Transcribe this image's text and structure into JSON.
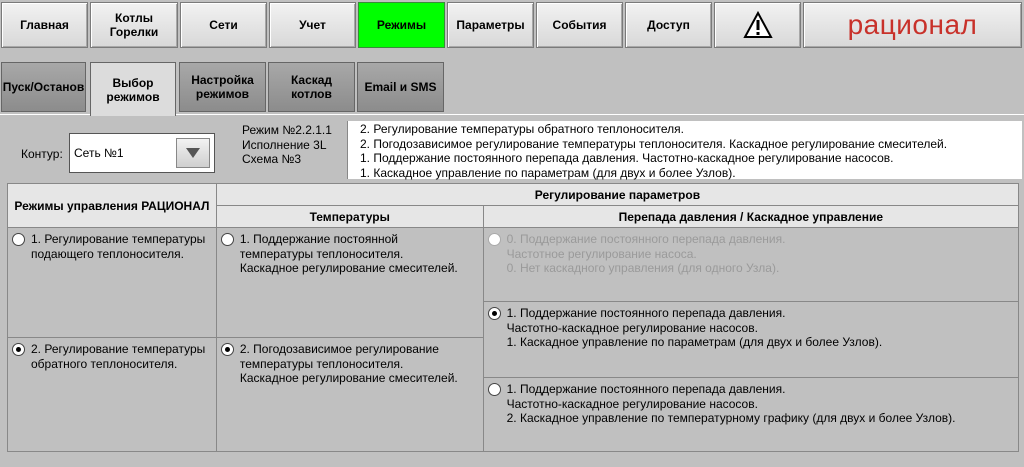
{
  "nav": {
    "items": [
      {
        "label": "Главная"
      },
      {
        "label": "Котлы\nГорелки"
      },
      {
        "label": "Сети"
      },
      {
        "label": "Учет"
      },
      {
        "label": "Режимы"
      },
      {
        "label": "Параметры"
      },
      {
        "label": "События"
      },
      {
        "label": "Доступ"
      }
    ],
    "brand": "рационал",
    "active_color": "#00ff00"
  },
  "tabs": [
    {
      "label": "Пуск/Останов"
    },
    {
      "label": "Выбор\nрежимов"
    },
    {
      "label": "Настройка\nрежимов"
    },
    {
      "label": "Каскад\nкотлов"
    },
    {
      "label": "Email и SMS"
    }
  ],
  "contour": {
    "label": "Контур:",
    "value": "Сеть №1"
  },
  "mode_info": {
    "line1": "Режим №2.2.1.1",
    "line2": "Исполнение 3L",
    "line3": "Схема №3"
  },
  "mode_desc": [
    "2. Регулирование температуры обратного теплоносителя.",
    "2. Погодозависимое регулирование температуры теплоносителя. Каскадное регулирование смесителей.",
    "1. Поддержание постоянного перепада давления. Частотно-каскадное регулирование насосов.",
    "1. Каскадное управление по параметрам (для двух и более Узлов)."
  ],
  "grid": {
    "col1_header": "Режимы управления РАЦИОНАЛ",
    "params_header": "Регулирование параметров",
    "temp_header": "Температуры",
    "pressure_header": "Перепада давления / Каскадное управление",
    "rational_modes": [
      {
        "text": "1. Регулирование температуры\nподающего теплоносителя.",
        "selected": false
      },
      {
        "text": "2. Регулирование температуры\nобратного теплоносителя.",
        "selected": true
      }
    ],
    "temp_modes": [
      {
        "text": "1. Поддержание постоянной\nтемпературы теплоносителя.\nКаскадное регулирование смесителей.",
        "selected": false
      },
      {
        "text": "2. Погодозависимое регулирование\nтемпературы теплоносителя.\nКаскадное регулирование смесителей.",
        "selected": true
      }
    ],
    "pressure_modes": [
      {
        "text": "0. Поддержание постоянного перепада давления.\nЧастотное регулирование насоса.\n0. Нет каскадного управления (для одного Узла).",
        "selected": false,
        "disabled": true
      },
      {
        "text": "1. Поддержание постоянного перепада давления.\nЧастотно-каскадное регулирование насосов.\n1. Каскадное управление по параметрам (для двух и более Узлов).",
        "selected": true,
        "disabled": false
      },
      {
        "text": "1. Поддержание постоянного перепада давления.\nЧастотно-каскадное регулирование насосов.\n2. Каскадное управление по температурному графику (для двух и более Узлов).",
        "selected": false,
        "disabled": false
      }
    ]
  }
}
